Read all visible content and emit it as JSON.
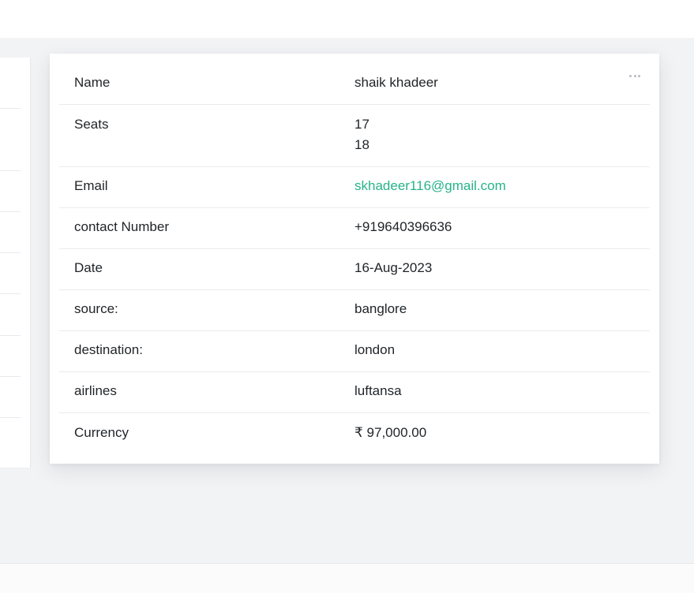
{
  "details": {
    "rows": [
      {
        "label": "Name",
        "value": "shaik khadeer"
      },
      {
        "label": "Seats",
        "values": [
          "17",
          "18"
        ]
      },
      {
        "label": "Email",
        "value": "skhadeer116@gmail.com"
      },
      {
        "label": "contact Number",
        "value": "+919640396636"
      },
      {
        "label": "Date",
        "value": "16-Aug-2023"
      },
      {
        "label": "source:",
        "value": "banglore"
      },
      {
        "label": "destination:",
        "value": "london"
      },
      {
        "label": "airlines",
        "value": "luftansa"
      },
      {
        "label": "Currency",
        "value": "₹ 97,000.00"
      }
    ]
  },
  "colors": {
    "background": "#f2f3f5",
    "card": "#ffffff",
    "link": "#27b38a",
    "divider": "#e9ebee"
  },
  "icons": {
    "card_menu": "more-horizontal-icon"
  }
}
